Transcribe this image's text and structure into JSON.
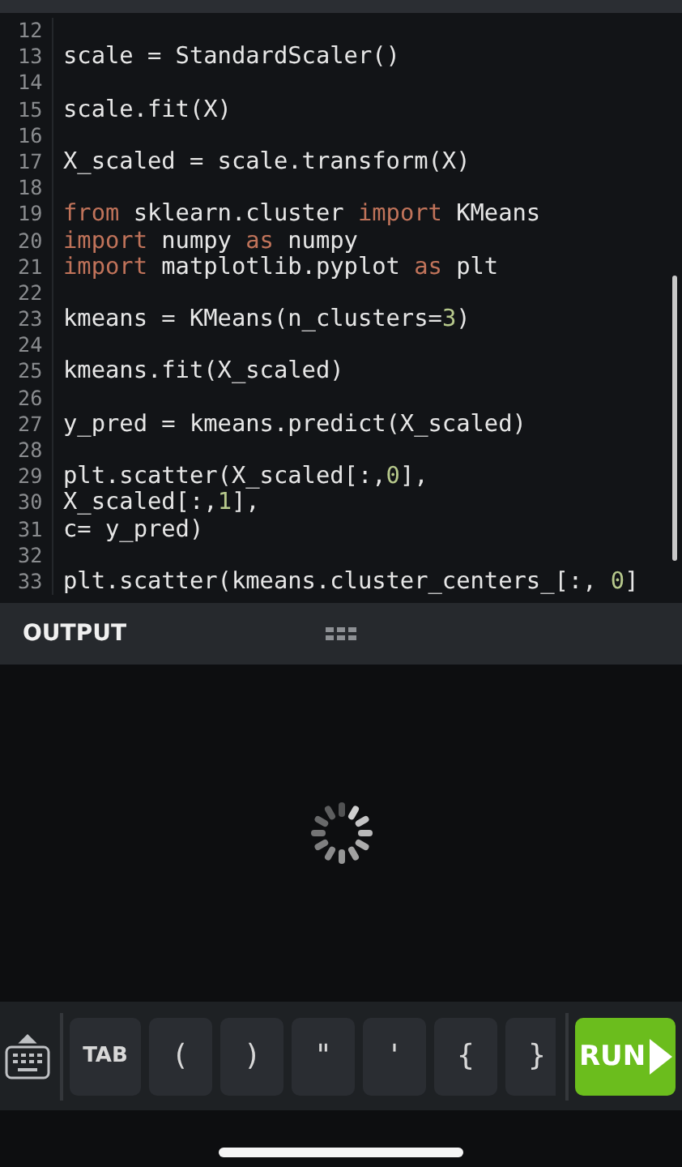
{
  "editor": {
    "lines": [
      {
        "number": "12"
      },
      {
        "number": "13",
        "tokens": [
          {
            "text": "scale = StandardScaler()",
            "kind": "plain"
          }
        ]
      },
      {
        "number": "14"
      },
      {
        "number": "15",
        "tokens": [
          {
            "text": "scale.fit(X)",
            "kind": "plain"
          }
        ]
      },
      {
        "number": "16"
      },
      {
        "number": "17",
        "tokens": [
          {
            "text": "X_scaled = scale.transform(X)",
            "kind": "plain"
          }
        ]
      },
      {
        "number": "18"
      },
      {
        "number": "19",
        "tokens": [
          {
            "text": "from",
            "kind": "keyword"
          },
          {
            "text": " sklearn.cluster ",
            "kind": "plain"
          },
          {
            "text": "import",
            "kind": "keyword"
          },
          {
            "text": " KMeans",
            "kind": "plain"
          }
        ]
      },
      {
        "number": "20",
        "tokens": [
          {
            "text": "import",
            "kind": "keyword"
          },
          {
            "text": " numpy ",
            "kind": "plain"
          },
          {
            "text": "as",
            "kind": "keyword"
          },
          {
            "text": " numpy",
            "kind": "plain"
          }
        ]
      },
      {
        "number": "21",
        "tokens": [
          {
            "text": "import",
            "kind": "keyword"
          },
          {
            "text": " matplotlib.pyplot ",
            "kind": "plain"
          },
          {
            "text": "as",
            "kind": "keyword"
          },
          {
            "text": " plt",
            "kind": "plain"
          }
        ]
      },
      {
        "number": "22"
      },
      {
        "number": "23",
        "tokens": [
          {
            "text": "kmeans = KMeans(n_clusters=",
            "kind": "plain"
          },
          {
            "text": "3",
            "kind": "number"
          },
          {
            "text": ")",
            "kind": "plain"
          }
        ]
      },
      {
        "number": "24"
      },
      {
        "number": "25",
        "tokens": [
          {
            "text": "kmeans.fit(X_scaled)",
            "kind": "plain"
          }
        ]
      },
      {
        "number": "26"
      },
      {
        "number": "27",
        "tokens": [
          {
            "text": "y_pred = kmeans.predict(X_scaled)",
            "kind": "plain"
          }
        ]
      },
      {
        "number": "28"
      },
      {
        "number": "29",
        "tokens": [
          {
            "text": "plt.scatter(X_scaled[:,",
            "kind": "plain"
          },
          {
            "text": "0",
            "kind": "number"
          },
          {
            "text": "],",
            "kind": "plain"
          }
        ]
      },
      {
        "number": "30",
        "tokens": [
          {
            "text": "X_scaled[:,",
            "kind": "plain"
          },
          {
            "text": "1",
            "kind": "number"
          },
          {
            "text": "],",
            "kind": "plain"
          }
        ]
      },
      {
        "number": "31",
        "tokens": [
          {
            "text": "c= y_pred)",
            "kind": "plain"
          }
        ]
      },
      {
        "number": "32"
      },
      {
        "number": "33",
        "tokens": [
          {
            "text": "plt.scatter(kmeans.cluster_centers_[:, ",
            "kind": "plain"
          },
          {
            "text": "0",
            "kind": "number"
          },
          {
            "text": "]",
            "kind": "plain"
          }
        ]
      }
    ]
  },
  "output": {
    "title": "OUTPUT"
  },
  "toolbar": {
    "keys": [
      "TAB",
      "(",
      ")",
      "\"",
      "'",
      "{",
      "}"
    ],
    "run": "RUN"
  }
}
